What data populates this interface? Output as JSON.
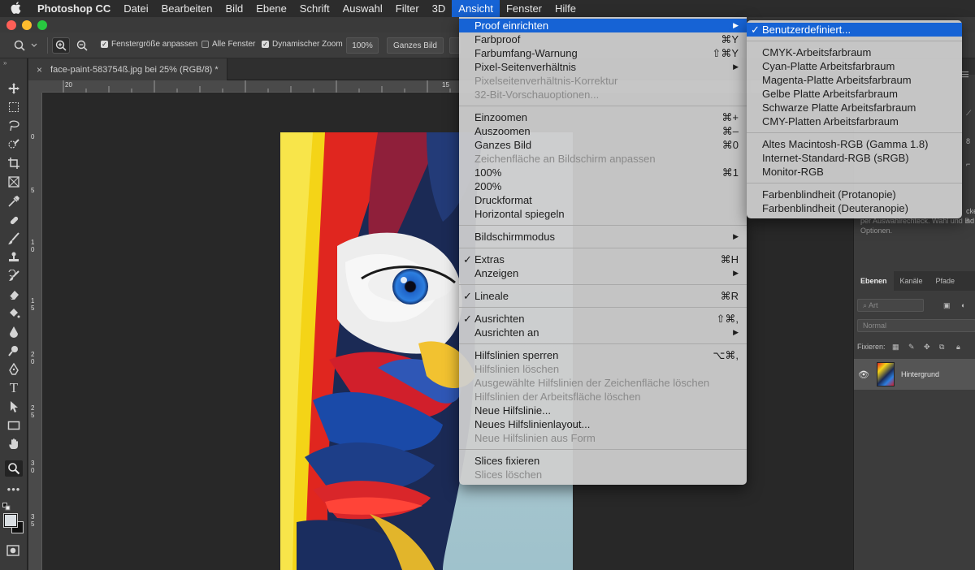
{
  "menubar": {
    "items": [
      "Photoshop CC",
      "Datei",
      "Bearbeiten",
      "Bild",
      "Ebene",
      "Schrift",
      "Auswahl",
      "Filter",
      "3D",
      "Ansicht",
      "Fenster",
      "Hilfe"
    ],
    "active": "Ansicht"
  },
  "options": {
    "fit_window": "Fenstergröße anpassen",
    "all_windows": "Alle Fenster",
    "dynamic_zoom": "Dynamischer Zoom",
    "zoom_value": "100%",
    "fit_screen": "Ganzes Bild"
  },
  "document": {
    "tab_title": "face-paint-583754ß.jpg bei 25% (RGB/8) *",
    "close": "×",
    "ruler_top": [
      "20",
      "15"
    ],
    "ruler_left": [
      "0",
      "5",
      "1\n0",
      "1\n5",
      "2\n0",
      "2\n5",
      "3\n0",
      "3\n5"
    ]
  },
  "ansicht_menu": [
    {
      "label": "Proof einrichten",
      "shortcut": "▶",
      "state": "highlighted"
    },
    {
      "label": "Farbproof",
      "shortcut": "⌘Y"
    },
    {
      "label": "Farbumfang-Warnung",
      "shortcut": "⇧⌘Y"
    },
    {
      "label": "Pixel-Seitenverhältnis",
      "shortcut": "▶"
    },
    {
      "label": "Pixelseitenverhältnis-Korrektur",
      "state": "disabled"
    },
    {
      "label": "32-Bit-Vorschauoptionen...",
      "state": "disabled"
    },
    {
      "sep": true
    },
    {
      "label": "Einzoomen",
      "shortcut": "⌘+"
    },
    {
      "label": "Auszoomen",
      "shortcut": "⌘–"
    },
    {
      "label": "Ganzes Bild",
      "shortcut": "⌘0"
    },
    {
      "label": "Zeichenfläche an Bildschirm anpassen",
      "state": "disabled"
    },
    {
      "label": "100%",
      "shortcut": "⌘1"
    },
    {
      "label": "200%"
    },
    {
      "label": "Druckformat"
    },
    {
      "label": "Horizontal spiegeln"
    },
    {
      "sep": true
    },
    {
      "label": "Bildschirmmodus",
      "shortcut": "▶"
    },
    {
      "sep": true
    },
    {
      "label": "Extras",
      "shortcut": "⌘H",
      "checked": true
    },
    {
      "label": "Anzeigen",
      "shortcut": "▶"
    },
    {
      "sep": true
    },
    {
      "label": "Lineale",
      "shortcut": "⌘R",
      "checked": true
    },
    {
      "sep": true
    },
    {
      "label": "Ausrichten",
      "shortcut": "⇧⌘,",
      "checked": true
    },
    {
      "label": "Ausrichten an",
      "shortcut": "▶"
    },
    {
      "sep": true
    },
    {
      "label": "Hilfslinien sperren",
      "shortcut": "⌥⌘,"
    },
    {
      "label": "Hilfslinien löschen",
      "state": "disabled"
    },
    {
      "label": "Ausgewählte Hilfslinien der Zeichenfläche löschen",
      "state": "disabled"
    },
    {
      "label": "Hilfslinien der Arbeitsfläche löschen",
      "state": "disabled"
    },
    {
      "label": "Neue Hilfslinie..."
    },
    {
      "label": "Neues Hilfslinienlayout..."
    },
    {
      "label": "Neue Hilfslinien aus Form",
      "state": "disabled"
    },
    {
      "sep": true
    },
    {
      "label": "Slices fixieren"
    },
    {
      "label": "Slices löschen",
      "state": "disabled"
    }
  ],
  "proof_submenu": [
    {
      "label": "Benutzerdefiniert...",
      "checked": true,
      "state": "highlighted"
    },
    {
      "sep": true
    },
    {
      "label": "CMYK-Arbeitsfarbraum"
    },
    {
      "label": "Cyan-Platte Arbeitsfarbraum"
    },
    {
      "label": "Magenta-Platte Arbeitsfarbraum"
    },
    {
      "label": "Gelbe Platte Arbeitsfarbraum"
    },
    {
      "label": "Schwarze Platte Arbeitsfarbraum"
    },
    {
      "label": "CMY-Platten Arbeitsfarbraum"
    },
    {
      "sep": true
    },
    {
      "label": "Altes Macintosh-RGB (Gamma 1.8)"
    },
    {
      "label": "Internet-Standard-RGB (sRGB)"
    },
    {
      "label": "Monitor-RGB"
    },
    {
      "sep": true
    },
    {
      "label": "Farbenblindheit (Protanopie)"
    },
    {
      "label": "Farbenblindheit (Deuteranopie)"
    }
  ],
  "right_panel": {
    "hint_line1": "per Auswahlrechteck. Wahl und B",
    "hint_line2": "Optionen.",
    "hint_fragment_top": "cker",
    "hint_fragment_mid": "nd",
    "ruler_fragment": "8",
    "tabs": [
      "Ebenen",
      "Kanäle",
      "Pfade"
    ],
    "filter_placeholder": "Art",
    "blend_mode": "Normal",
    "lock_label": "Fixieren:",
    "layer_name": "Hintergrund"
  },
  "colors": {
    "accent": "#1663d5",
    "menu_bg": "#cecece",
    "app_bg": "#262626"
  }
}
